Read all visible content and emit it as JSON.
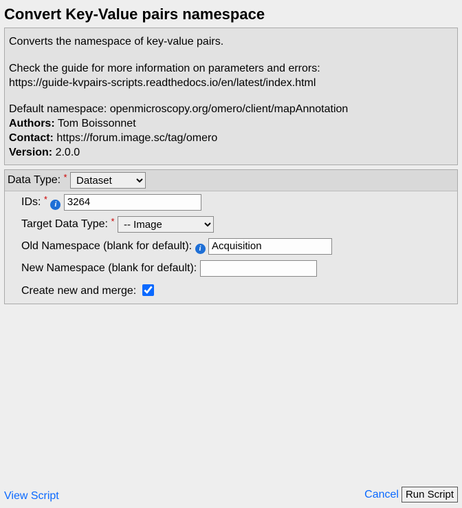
{
  "title": "Convert Key-Value pairs namespace",
  "description": {
    "line1": "Converts the namespace of key-value pairs.",
    "guide1": "Check the guide for more information on parameters and errors:",
    "guide2": "https://guide-kvpairs-scripts.readthedocs.io/en/latest/index.html",
    "default_ns": "Default namespace: openmicroscopy.org/omero/client/mapAnnotation",
    "authors_label": "Authors:",
    "authors_value": " Tom Boissonnet",
    "contact_label": "Contact:",
    "contact_value": " https://forum.image.sc/tag/omero",
    "version_label": "Version:",
    "version_value": " 2.0.0"
  },
  "form": {
    "data_type_label": "Data Type: ",
    "data_type_value": "Dataset",
    "ids_label": "IDs: ",
    "ids_value": "3264",
    "target_label": "Target Data Type: ",
    "target_value": "-- Image",
    "old_ns_label": "Old Namespace (blank for default):",
    "old_ns_value": "Acquisition",
    "new_ns_label": "New Namespace (blank for default):",
    "new_ns_value": "",
    "merge_label": "Create new and merge:"
  },
  "footer": {
    "view_script": "View Script",
    "cancel": "Cancel",
    "run": "Run Script"
  },
  "glyph": {
    "required": "*",
    "info": "i"
  }
}
